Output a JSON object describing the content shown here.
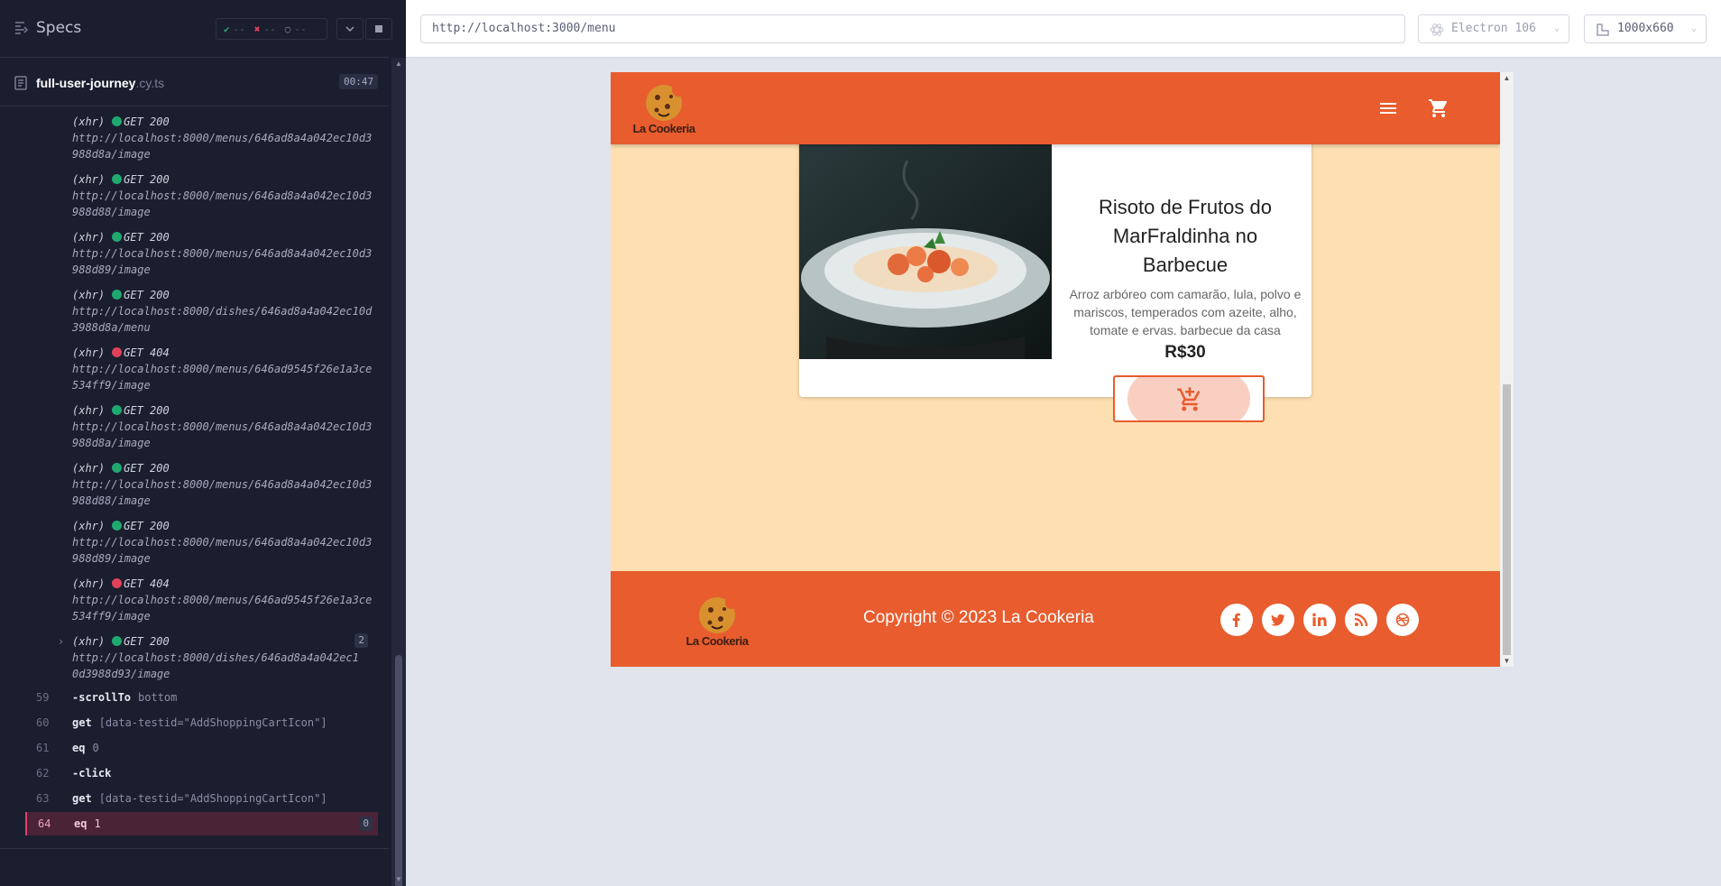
{
  "runner": {
    "specs_label": "Specs",
    "stats": {
      "passed": "--",
      "failed": "--",
      "pending": "--"
    },
    "spec_file": {
      "name": "full-user-journey",
      "ext": ".cy.ts",
      "duration": "00:47"
    },
    "xhr_logs": [
      {
        "tag": "(xhr)",
        "status": "ok",
        "method": "GET 200",
        "url1": "http://localhost:8000/menus/646ad8a4a042ec10d3",
        "url2": "988d8a/image"
      },
      {
        "tag": "(xhr)",
        "status": "ok",
        "method": "GET 200",
        "url1": "http://localhost:8000/menus/646ad8a4a042ec10d3",
        "url2": "988d88/image"
      },
      {
        "tag": "(xhr)",
        "status": "ok",
        "method": "GET 200",
        "url1": "http://localhost:8000/menus/646ad8a4a042ec10d3",
        "url2": "988d89/image"
      },
      {
        "tag": "(xhr)",
        "status": "ok",
        "method": "GET 200",
        "url1": "http://localhost:8000/dishes/646ad8a4a042ec10d",
        "url2": "3988d8a/menu"
      },
      {
        "tag": "(xhr)",
        "status": "err",
        "method": "GET 404",
        "url1": "http://localhost:8000/menus/646ad9545f26e1a3ce",
        "url2": "534ff9/image"
      },
      {
        "tag": "(xhr)",
        "status": "ok",
        "method": "GET 200",
        "url1": "http://localhost:8000/menus/646ad8a4a042ec10d3",
        "url2": "988d8a/image"
      },
      {
        "tag": "(xhr)",
        "status": "ok",
        "method": "GET 200",
        "url1": "http://localhost:8000/menus/646ad8a4a042ec10d3",
        "url2": "988d88/image"
      },
      {
        "tag": "(xhr)",
        "status": "ok",
        "method": "GET 200",
        "url1": "http://localhost:8000/menus/646ad8a4a042ec10d3",
        "url2": "988d89/image"
      },
      {
        "tag": "(xhr)",
        "status": "err",
        "method": "GET 404",
        "url1": "http://localhost:8000/menus/646ad9545f26e1a3ce",
        "url2": "534ff9/image"
      },
      {
        "tag": "(xhr)",
        "status": "ok",
        "method": "GET 200",
        "url1": "http://localhost:8000/dishes/646ad8a4a042ec1",
        "url2": "0d3988d93/image",
        "count": "2"
      }
    ],
    "commands": [
      {
        "num": "59",
        "name": "-scrollTo",
        "arg": "bottom"
      },
      {
        "num": "60",
        "name": "get",
        "arg": "[data-testid=\"AddShoppingCartIcon\"]"
      },
      {
        "num": "61",
        "name": "eq",
        "arg": "0"
      },
      {
        "num": "62",
        "name": "-click",
        "arg": ""
      },
      {
        "num": "63",
        "name": "get",
        "arg": "[data-testid=\"AddShoppingCartIcon\"]"
      },
      {
        "num": "64",
        "name": "eq",
        "arg": "1",
        "badge": "0"
      }
    ]
  },
  "toolbar": {
    "url": "http://localhost:3000/menu",
    "browser": "Electron 106",
    "viewport": "1000x660"
  },
  "app": {
    "brand": "La Cookeria",
    "dish": {
      "title": "Risoto de Frutos do MarFraldinha no Barbecue",
      "description": "Arroz arbóreo com camarão, lula, polvo e mariscos, temperados com azeite, alho, tomate e ervas. barbecue da casa",
      "price": "R$30"
    },
    "footer": {
      "copyright": "Copyright © 2023 La Cookeria",
      "socials": [
        "facebook-icon",
        "twitter-icon",
        "linkedin-icon",
        "rss-icon",
        "dribbble-icon"
      ]
    },
    "colors": {
      "primary": "#e85c2e",
      "background": "#fddfb1"
    }
  }
}
